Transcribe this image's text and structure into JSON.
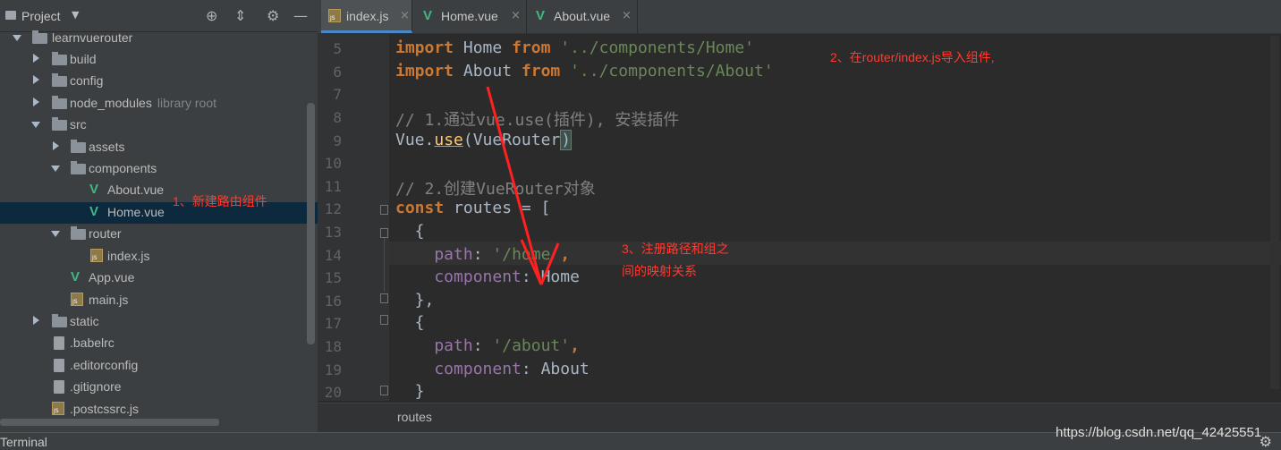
{
  "sidebar": {
    "title": "Project",
    "items": [
      {
        "label": "learnvuerouter",
        "hint": ""
      },
      {
        "label": "build",
        "hint": ""
      },
      {
        "label": "config",
        "hint": ""
      },
      {
        "label": "node_modules",
        "hint": "library root"
      },
      {
        "label": "src",
        "hint": ""
      },
      {
        "label": "assets",
        "hint": ""
      },
      {
        "label": "components",
        "hint": ""
      },
      {
        "label": "About.vue",
        "hint": ""
      },
      {
        "label": "Home.vue",
        "hint": ""
      },
      {
        "label": "router",
        "hint": ""
      },
      {
        "label": "index.js",
        "hint": ""
      },
      {
        "label": "App.vue",
        "hint": ""
      },
      {
        "label": "main.js",
        "hint": ""
      },
      {
        "label": "static",
        "hint": ""
      },
      {
        "label": ".babelrc",
        "hint": ""
      },
      {
        "label": ".editorconfig",
        "hint": ""
      },
      {
        "label": ".gitignore",
        "hint": ""
      },
      {
        "label": ".postcssrc.js",
        "hint": ""
      }
    ]
  },
  "tabs": [
    {
      "label": "index.js",
      "active": true
    },
    {
      "label": "Home.vue",
      "active": false
    },
    {
      "label": "About.vue",
      "active": false
    }
  ],
  "editor": {
    "line_numbers": [
      "5",
      "6",
      "7",
      "8",
      "9",
      "10",
      "11",
      "12",
      "13",
      "14",
      "15",
      "16",
      "17",
      "18",
      "19",
      "20"
    ],
    "lines": {
      "l5": {
        "kw1": "import",
        "name": " Home ",
        "kw2": "from",
        "str": " '../components/Home'"
      },
      "l6": {
        "kw1": "import",
        "name": " About ",
        "kw2": "from",
        "str": " '../components/About'"
      },
      "l8": {
        "comment": "// 1.通过vue.use(插件), 安装插件"
      },
      "l9": {
        "obj": "Vue.",
        "fn": "use",
        "open": "(VueRouter",
        "close": ")"
      },
      "l11": {
        "comment": "// 2.创建VueRouter对象"
      },
      "l12": {
        "kw": "const",
        "rest": " routes = ["
      },
      "l13": {
        "text": "  {"
      },
      "l14": {
        "prop": "    path",
        "colon": ": ",
        "str": "'/home'",
        "comma": ","
      },
      "l15": {
        "prop": "    component",
        "colon": ": ",
        "value": "Home"
      },
      "l16": {
        "text": "  },"
      },
      "l17": {
        "text": "  {"
      },
      "l18": {
        "prop": "    path",
        "colon": ": ",
        "str": "'/about'",
        "comma": ","
      },
      "l19": {
        "prop": "    component",
        "colon": ": ",
        "value": "About"
      },
      "l20": {
        "text": "  }"
      }
    },
    "breadcrumb": "routes"
  },
  "status": {
    "terminal_label": "Terminal"
  },
  "annotations": {
    "a1": "1、新建路由组件",
    "a2": "2、在router/index.js导入组件,",
    "a3_line1": "3、注册路径和组之",
    "a3_line2": "间的映射关系",
    "color": "#ff3b30"
  },
  "watermark": "https://blog.csdn.net/qq_42425551"
}
